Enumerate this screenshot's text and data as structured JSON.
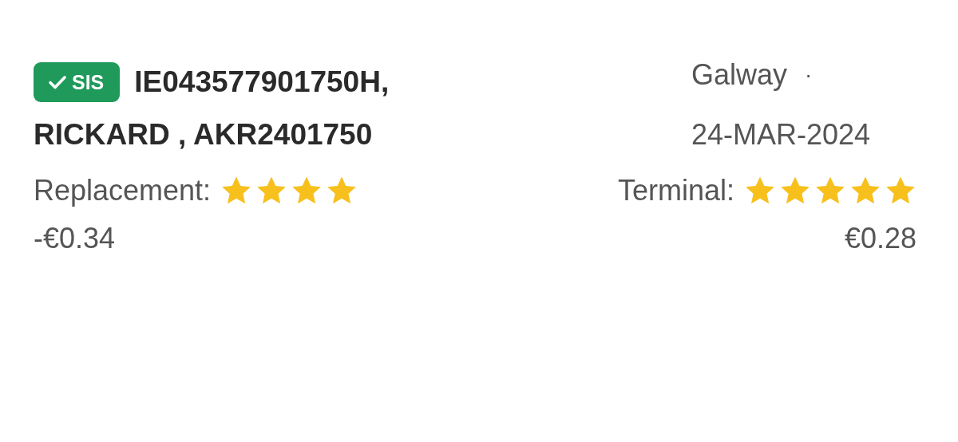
{
  "record": {
    "badge": {
      "label": "SIS",
      "verified": true
    },
    "title_line_1": "IE043577901750H,",
    "title_line_2": "RICKARD , AKR2401750",
    "location": "Galway",
    "separator": "·",
    "date": "24-MAR-2024",
    "ratings": [
      {
        "label": "Replacement:",
        "stars": 4,
        "amount": "-€0.34"
      },
      {
        "label": "Terminal:",
        "stars": 5,
        "amount": "€0.28"
      }
    ]
  }
}
